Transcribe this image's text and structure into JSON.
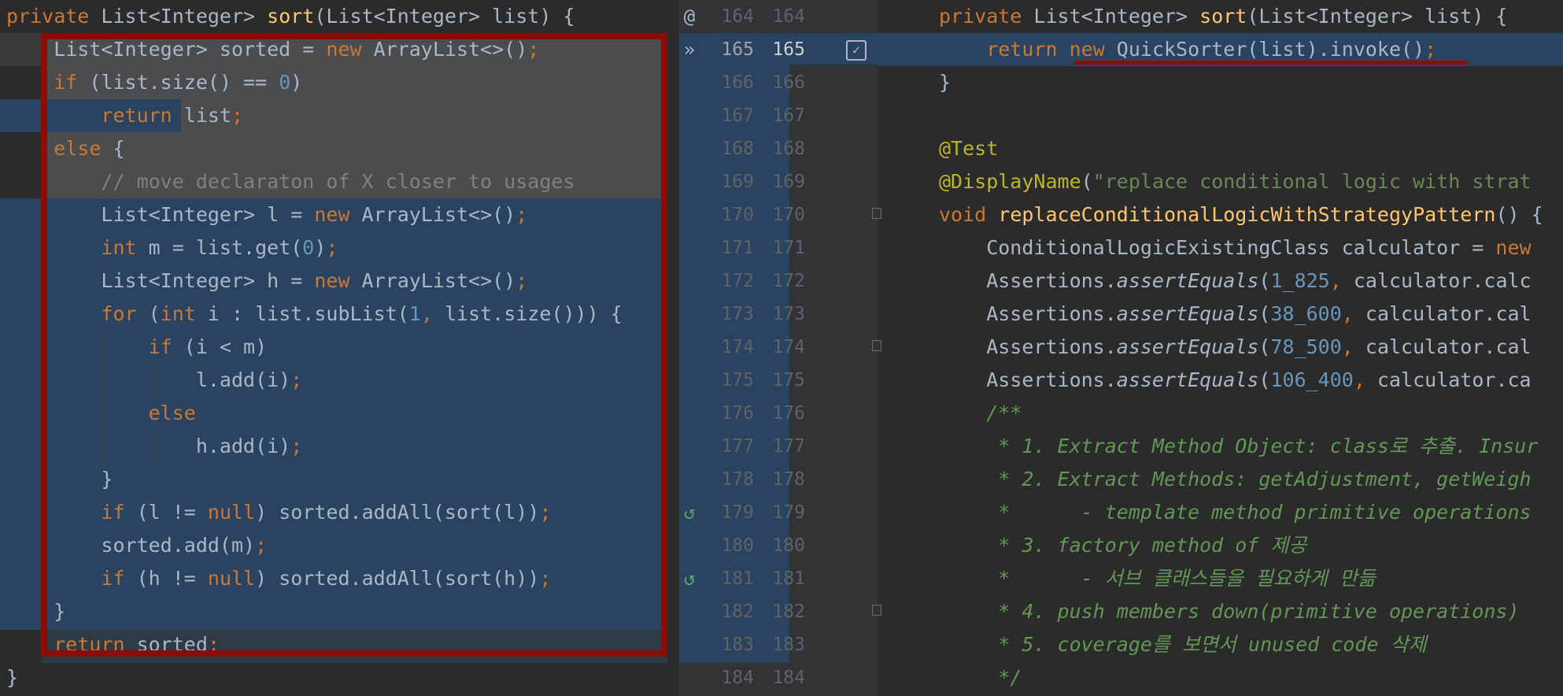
{
  "left_pane": {
    "lines": [
      [
        {
          "t": "private",
          "c": "kw"
        },
        {
          "t": " List<Integer> "
        },
        {
          "t": "sort",
          "c": "fn"
        },
        {
          "t": "(List<Integer> list) {"
        }
      ],
      [
        {
          "t": "    List<Integer> sorted = "
        },
        {
          "t": "new",
          "c": "kw"
        },
        {
          "t": " ArrayList<>()"
        },
        {
          "t": ";",
          "c": "kw"
        }
      ],
      [
        {
          "t": "    "
        },
        {
          "t": "if",
          "c": "kw"
        },
        {
          "t": " (list.size() == "
        },
        {
          "t": "0",
          "c": "num"
        },
        {
          "t": ")"
        }
      ],
      [
        {
          "t": "        "
        },
        {
          "t": "return",
          "c": "kw"
        },
        {
          "t": " list"
        },
        {
          "t": ";",
          "c": "kw"
        }
      ],
      [
        {
          "t": "    "
        },
        {
          "t": "else",
          "c": "kw"
        },
        {
          "t": " {"
        }
      ],
      [
        {
          "t": "        "
        },
        {
          "t": "// move declaraton of X closer to usages",
          "c": "cm"
        }
      ],
      [
        {
          "t": "        List<Integer> l = "
        },
        {
          "t": "new",
          "c": "kw"
        },
        {
          "t": " ArrayList<>()"
        },
        {
          "t": ";",
          "c": "kw"
        }
      ],
      [
        {
          "t": "        "
        },
        {
          "t": "int",
          "c": "kw"
        },
        {
          "t": " m = list.get("
        },
        {
          "t": "0",
          "c": "num"
        },
        {
          "t": ")"
        },
        {
          "t": ";",
          "c": "kw"
        }
      ],
      [
        {
          "t": "        List<Integer> h = "
        },
        {
          "t": "new",
          "c": "kw"
        },
        {
          "t": " ArrayList<>()"
        },
        {
          "t": ";",
          "c": "kw"
        }
      ],
      [
        {
          "t": "        "
        },
        {
          "t": "for",
          "c": "kw"
        },
        {
          "t": " ("
        },
        {
          "t": "int",
          "c": "kw"
        },
        {
          "t": " i : list.subList("
        },
        {
          "t": "1",
          "c": "num"
        },
        {
          "t": ", ",
          "c": "kw"
        },
        {
          "t": "list.size())) {"
        }
      ],
      [
        {
          "t": "            "
        },
        {
          "t": "if",
          "c": "kw"
        },
        {
          "t": " (i < m)"
        }
      ],
      [
        {
          "t": "                l.add(i)"
        },
        {
          "t": ";",
          "c": "kw"
        }
      ],
      [
        {
          "t": "            "
        },
        {
          "t": "else",
          "c": "kw"
        }
      ],
      [
        {
          "t": "                h.add(i)"
        },
        {
          "t": ";",
          "c": "kw"
        }
      ],
      [
        {
          "t": "        }"
        }
      ],
      [
        {
          "t": "        "
        },
        {
          "t": "if",
          "c": "kw"
        },
        {
          "t": " (l != "
        },
        {
          "t": "null",
          "c": "kw"
        },
        {
          "t": ") sorted.addAll(sort(l))"
        },
        {
          "t": ";",
          "c": "kw"
        }
      ],
      [
        {
          "t": "        sorted.add(m)"
        },
        {
          "t": ";",
          "c": "kw"
        }
      ],
      [
        {
          "t": "        "
        },
        {
          "t": "if",
          "c": "kw"
        },
        {
          "t": " (h != "
        },
        {
          "t": "null",
          "c": "kw"
        },
        {
          "t": ") sorted.addAll(sort(h))"
        },
        {
          "t": ";",
          "c": "kw"
        }
      ],
      [
        {
          "t": "    }"
        }
      ],
      [
        {
          "t": "    "
        },
        {
          "t": "return",
          "c": "kw"
        },
        {
          "t": " sorted"
        },
        {
          "t": ";",
          "c": "kw"
        }
      ],
      [
        {
          "t": "}"
        }
      ]
    ]
  },
  "gutter": {
    "left_numbers": [
      "164",
      "165",
      "166",
      "167",
      "168",
      "169",
      "170",
      "171",
      "172",
      "173",
      "174",
      "175",
      "176",
      "177",
      "178",
      "179",
      "180",
      "181",
      "182",
      "183",
      "184"
    ],
    "right_numbers": [
      "164",
      "165",
      "166",
      "167",
      "168",
      "169",
      "170",
      "171",
      "172",
      "173",
      "174",
      "175",
      "176",
      "177",
      "178",
      "179",
      "180",
      "181",
      "182",
      "183",
      "184"
    ],
    "icons": {
      "line_164": "@",
      "line_165": "»",
      "line_179": "↺",
      "line_181": "↺"
    },
    "checkbox_mark": "✓"
  },
  "right_pane": {
    "lines": [
      [
        {
          "t": "private",
          "c": "kw"
        },
        {
          "t": " List<Integer> "
        },
        {
          "t": "sort",
          "c": "fn"
        },
        {
          "t": "(List<Integer> list) {"
        }
      ],
      [
        {
          "t": "    "
        },
        {
          "t": "return",
          "c": "kw"
        },
        {
          "t": " "
        },
        {
          "t": "new",
          "c": "kw"
        },
        {
          "t": " QuickSorter(list).invoke()"
        },
        {
          "t": ";",
          "c": "kw"
        }
      ],
      [
        {
          "t": "}"
        }
      ],
      [
        {
          "t": ""
        }
      ],
      [
        {
          "t": "@Test",
          "c": "ann"
        }
      ],
      [
        {
          "t": "@DisplayName",
          "c": "ann"
        },
        {
          "t": "("
        },
        {
          "t": "\"replace conditional logic with strat",
          "c": "str"
        }
      ],
      [
        {
          "t": "void",
          "c": "kw"
        },
        {
          "t": " "
        },
        {
          "t": "replaceConditionalLogicWithStrategyPattern",
          "c": "fn"
        },
        {
          "t": "() {"
        }
      ],
      [
        {
          "t": "    ConditionalLogicExistingClass calculator = "
        },
        {
          "t": "new",
          "c": "kw"
        }
      ],
      [
        {
          "t": "    Assertions."
        },
        {
          "t": "assertEquals",
          "c": "it"
        },
        {
          "t": "("
        },
        {
          "t": "1_825",
          "c": "num"
        },
        {
          "t": ", ",
          "c": "kw"
        },
        {
          "t": "calculator.calc"
        }
      ],
      [
        {
          "t": "    Assertions."
        },
        {
          "t": "assertEquals",
          "c": "it"
        },
        {
          "t": "("
        },
        {
          "t": "38_600",
          "c": "num"
        },
        {
          "t": ", ",
          "c": "kw"
        },
        {
          "t": "calculator.cal"
        }
      ],
      [
        {
          "t": "    Assertions."
        },
        {
          "t": "assertEquals",
          "c": "it"
        },
        {
          "t": "("
        },
        {
          "t": "78_500",
          "c": "num"
        },
        {
          "t": ", ",
          "c": "kw"
        },
        {
          "t": "calculator.cal"
        }
      ],
      [
        {
          "t": "    Assertions."
        },
        {
          "t": "assertEquals",
          "c": "it"
        },
        {
          "t": "("
        },
        {
          "t": "106_400",
          "c": "num"
        },
        {
          "t": ", ",
          "c": "kw"
        },
        {
          "t": "calculator.ca"
        }
      ],
      [
        {
          "t": "    /**",
          "c": "doc"
        }
      ],
      [
        {
          "t": "     * 1. Extract Method Object: class로 추출. Insur",
          "c": "doc"
        }
      ],
      [
        {
          "t": "     * 2. Extract Methods: getAdjustment, getWeigh",
          "c": "doc"
        }
      ],
      [
        {
          "t": "     *      - template method primitive operations",
          "c": "doc"
        }
      ],
      [
        {
          "t": "     * 3. factory method of 제공",
          "c": "doc"
        }
      ],
      [
        {
          "t": "     *      - 서브 클래스들을 필요하게 만듦",
          "c": "doc"
        }
      ],
      [
        {
          "t": "     * 4. push members down(primitive operations) ",
          "c": "doc"
        }
      ],
      [
        {
          "t": "     * 5. coverage를 보면서 unused code 삭제",
          "c": "doc"
        }
      ],
      [
        {
          "t": "     */",
          "c": "doc"
        }
      ]
    ]
  },
  "colors": {
    "editor_bg": "#2b2b2b",
    "gutter_bg": "#313335",
    "changed_bg": "#294361",
    "modified_bg": "#4a4c4d",
    "highlight_border": "#8b0d0a"
  }
}
